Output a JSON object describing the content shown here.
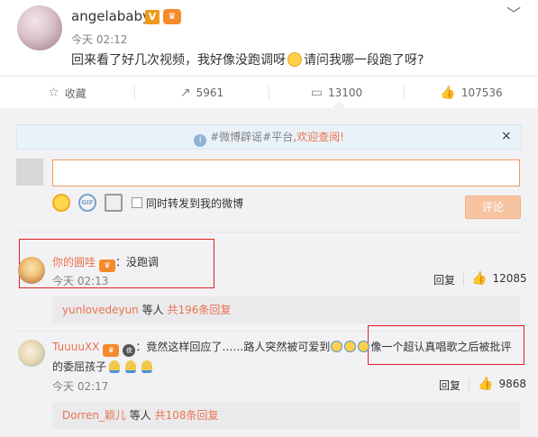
{
  "post": {
    "username": "angelababy",
    "verified_badge": "V",
    "time": "今天 02:12",
    "text_before_emoji": "回来看了好几次视频，我好像没跑调呀",
    "text_after_emoji": "请问我哪一段跑了呀?"
  },
  "actions": {
    "favorite": "收藏",
    "repost": "5961",
    "comment": "13100",
    "like": "107536"
  },
  "notice": {
    "text": "#微博辟谣#平台,",
    "link": "欢迎查阅!",
    "close": "×"
  },
  "composer": {
    "input_value": "",
    "repost_label": "同时转发到我的微博",
    "submit_label": "评论"
  },
  "comments": [
    {
      "user": "你的圓哇",
      "text": "：没跑调",
      "time": "今天 02:13",
      "reply": "回复",
      "likes": "12085",
      "sub_user": "yunlovedeyun",
      "sub_mid": "等人",
      "sub_count": "共196条回复"
    },
    {
      "user": "TuuuuXX",
      "text_a": "：竟然这样回应了……路人突然被可爱到",
      "text_b": "像一个超认真唱歌之后被批评",
      "text_c": "的委屈孩子",
      "time": "今天 02:17",
      "reply": "回复",
      "likes": "9868",
      "sub_user": "Dorren_颖儿",
      "sub_mid": "等人",
      "sub_count": "共108条回复"
    }
  ],
  "icons": [
    "star-icon",
    "repost-icon",
    "comment-icon",
    "thumbs-up-icon",
    "info-icon",
    "chevron-down-icon",
    "smile-icon",
    "gif-icon",
    "image-icon"
  ],
  "colors": {
    "accent": "#eb7350",
    "highlight_box": "#e02020",
    "submit_disabled": "#f7c4a2"
  }
}
